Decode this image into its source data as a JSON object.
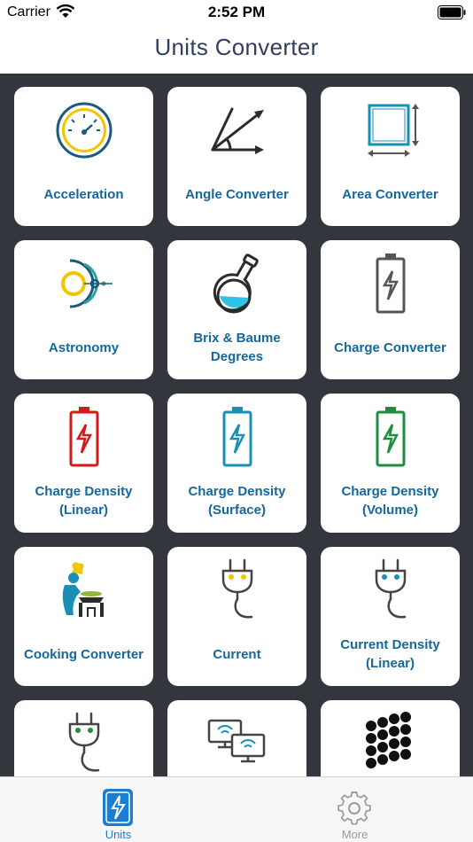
{
  "status_bar": {
    "carrier": "Carrier",
    "time": "2:52 PM"
  },
  "nav": {
    "title": "Units Converter"
  },
  "tiles": [
    {
      "label": "Acceleration",
      "icon": "speedometer-icon"
    },
    {
      "label": "Angle Converter",
      "icon": "angle-icon"
    },
    {
      "label": "Area Converter",
      "icon": "area-icon"
    },
    {
      "label": "Astronomy",
      "icon": "orbit-icon"
    },
    {
      "label": "Brix & Baume\nDegrees",
      "icon": "flask-icon"
    },
    {
      "label": "Charge Converter",
      "icon": "battery-gray-icon"
    },
    {
      "label": "Charge Density\n(Linear)",
      "icon": "battery-red-icon"
    },
    {
      "label": "Charge Density\n(Surface)",
      "icon": "battery-blue-icon"
    },
    {
      "label": "Charge Density\n(Volume)",
      "icon": "battery-green-icon"
    },
    {
      "label": "Cooking Converter",
      "icon": "chef-icon"
    },
    {
      "label": "Current",
      "icon": "plug-yellow-icon"
    },
    {
      "label": "Current Density\n(Linear)",
      "icon": "plug-blue-icon"
    },
    {
      "label": "",
      "icon": "plug-green-icon"
    },
    {
      "label": "",
      "icon": "network-computers-icon"
    },
    {
      "label": "",
      "icon": "spheres-icon"
    }
  ],
  "tab_bar": {
    "tabs": [
      {
        "label": "Units",
        "icon": "calculator-icon",
        "active": true
      },
      {
        "label": "More",
        "icon": "gear-icon",
        "active": false
      }
    ]
  },
  "colors": {
    "accent": "#15679c",
    "tab_active": "#1a7fd4",
    "tab_inactive": "#9a9a9a",
    "background": "#33363d",
    "title": "#2f3f5c"
  }
}
